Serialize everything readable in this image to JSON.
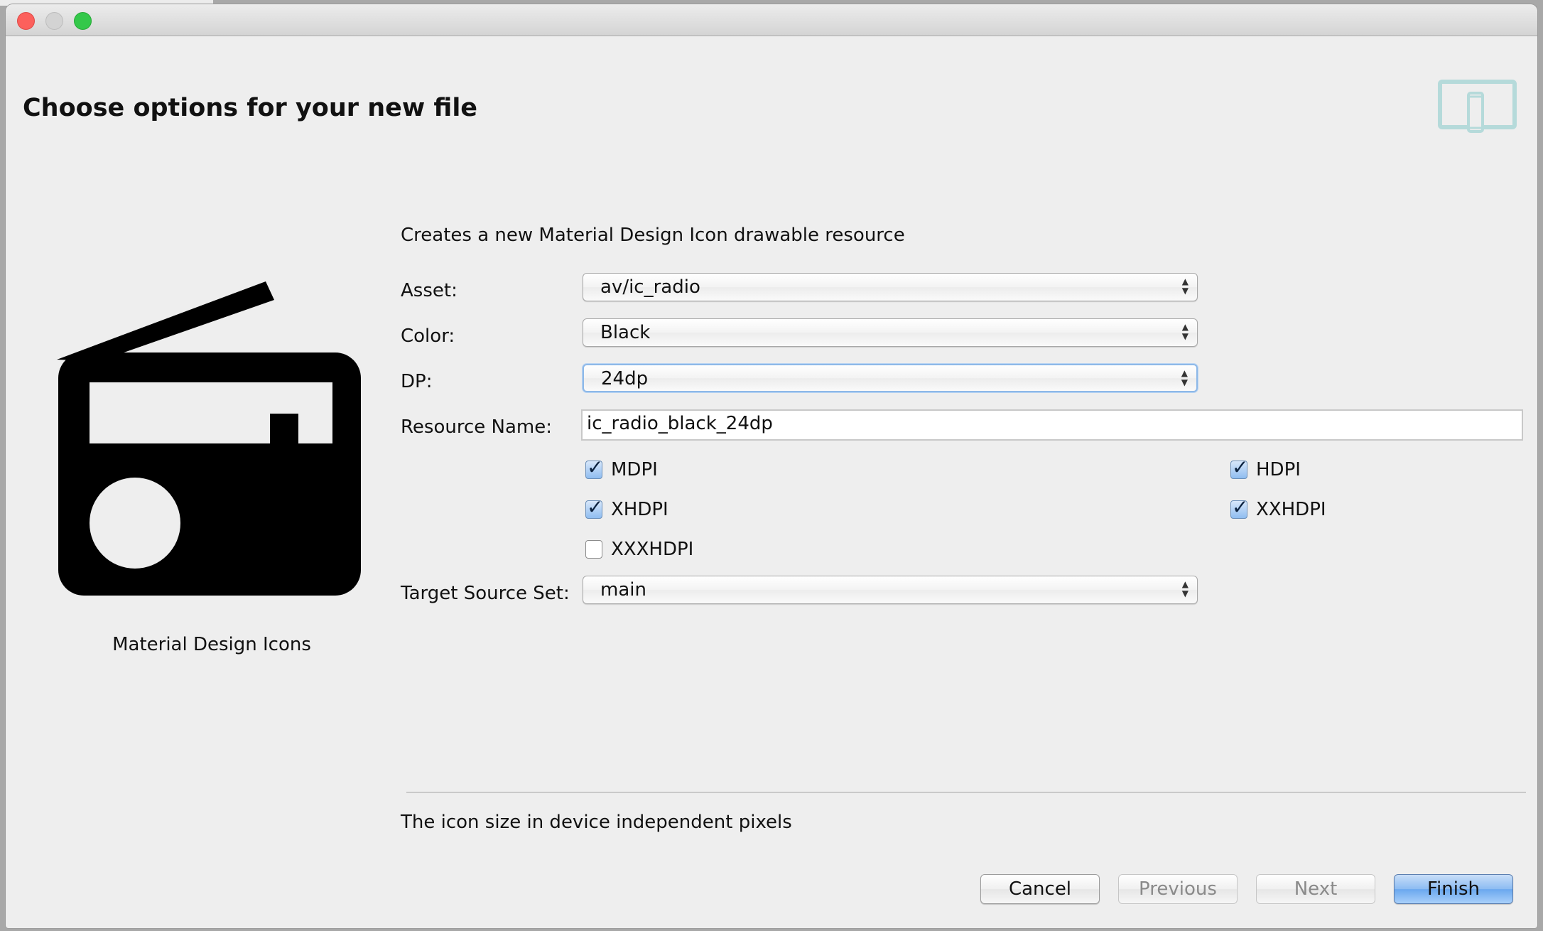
{
  "window": {
    "controls": [
      "close",
      "minimize",
      "maximize"
    ]
  },
  "header": {
    "title": "Choose options for your new file",
    "icon": "device-tablet-phone-icon"
  },
  "preview": {
    "icon": "radio-icon",
    "caption": "Material Design Icons"
  },
  "form": {
    "description": "Creates a new Material Design Icon drawable resource",
    "asset": {
      "label": "Asset:",
      "value": "av/ic_radio"
    },
    "color": {
      "label": "Color:",
      "value": "Black"
    },
    "dp": {
      "label": "DP:",
      "value": "24dp"
    },
    "resource_name": {
      "label": "Resource Name:",
      "value": "ic_radio_black_24dp"
    },
    "densities": [
      {
        "label": "MDPI",
        "checked": true
      },
      {
        "label": "HDPI",
        "checked": true
      },
      {
        "label": "XHDPI",
        "checked": true
      },
      {
        "label": "XXHDPI",
        "checked": true
      },
      {
        "label": "XXXHDPI",
        "checked": false
      }
    ],
    "target_source_set": {
      "label": "Target Source Set:",
      "value": "main"
    }
  },
  "help_text": "The icon size in device independent pixels",
  "buttons": {
    "cancel": "Cancel",
    "previous": "Previous",
    "next": "Next",
    "finish": "Finish"
  },
  "colors": {
    "accent": "#8db8e8",
    "device_icon": "#b5dada",
    "primary_button": "#8cbcf2"
  }
}
